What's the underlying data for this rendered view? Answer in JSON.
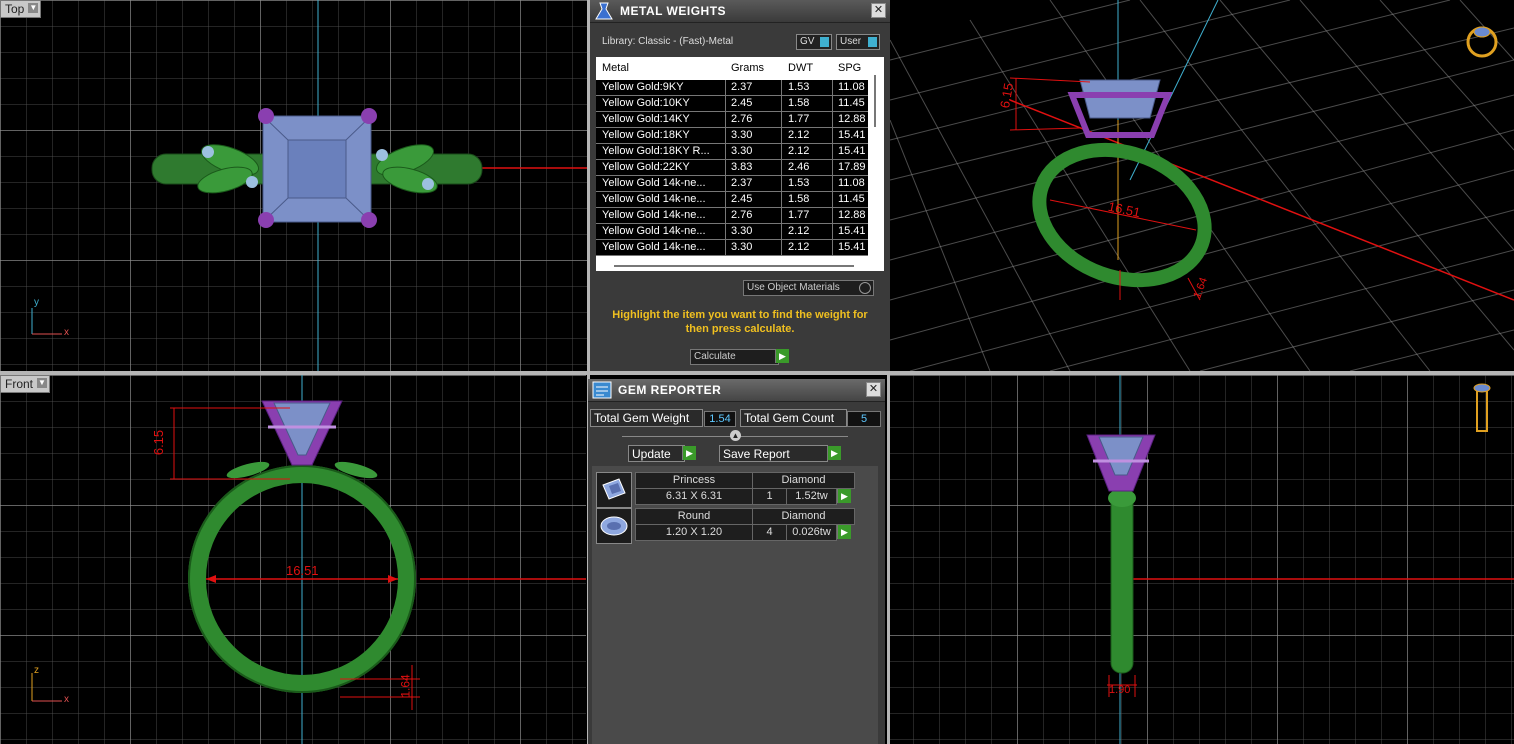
{
  "viewports": {
    "top": {
      "label": "Top",
      "axis_x": "x",
      "axis_y": "y"
    },
    "front": {
      "label": "Front",
      "axis_x": "x",
      "axis_y": "z",
      "dim_height": "6.15",
      "dim_width": "16.51",
      "dim_band": "1.64"
    },
    "perspective": {
      "dim_height": "6.15",
      "dim_width": "16.51",
      "dim_band": "1.64"
    },
    "side": {
      "dim_band": "1.90"
    }
  },
  "metal_weights": {
    "title": "METAL WEIGHTS",
    "library": "Library: Classic - (Fast)-Metal",
    "toggle_gv": "GV",
    "toggle_user": "User",
    "columns": [
      "Metal",
      "Grams",
      "DWT",
      "SPG"
    ],
    "rows": [
      [
        "Yellow Gold:9KY",
        "2.37",
        "1.53",
        "11.08"
      ],
      [
        "Yellow Gold:10KY",
        "2.45",
        "1.58",
        "11.45"
      ],
      [
        "Yellow Gold:14KY",
        "2.76",
        "1.77",
        "12.88"
      ],
      [
        "Yellow Gold:18KY",
        "3.30",
        "2.12",
        "15.41"
      ],
      [
        "Yellow Gold:18KY R...",
        "3.30",
        "2.12",
        "15.41"
      ],
      [
        "Yellow Gold:22KY",
        "3.83",
        "2.46",
        "17.89"
      ],
      [
        "Yellow Gold 14k-ne...",
        "2.37",
        "1.53",
        "11.08"
      ],
      [
        "Yellow Gold 14k-ne...",
        "2.45",
        "1.58",
        "11.45"
      ],
      [
        "Yellow Gold 14k-ne...",
        "2.76",
        "1.77",
        "12.88"
      ],
      [
        "Yellow Gold 14k-ne...",
        "3.30",
        "2.12",
        "15.41"
      ],
      [
        "Yellow Gold 14k-ne...",
        "3.30",
        "2.12",
        "15.41"
      ]
    ],
    "use_object_materials": "Use Object Materials",
    "hint": "Highlight the item you want to find the weight for then press calculate.",
    "calculate_label": "Calculate"
  },
  "gem_reporter": {
    "title": "GEM REPORTER",
    "total_weight_label": "Total Gem Weight",
    "total_weight_value": "1.54",
    "total_count_label": "Total Gem Count",
    "total_count_value": "5",
    "update_label": "Update",
    "save_report_label": "Save Report",
    "gems": [
      {
        "shape": "Princess",
        "material": "Diamond",
        "size": "6.31 X 6.31",
        "count": "1",
        "weight": "1.52tw"
      },
      {
        "shape": "Round",
        "material": "Diamond",
        "size": "1.20 X 1.20",
        "count": "4",
        "weight": "0.026tw"
      }
    ]
  },
  "colors": {
    "band": "#2f8a2f",
    "prongs": "#8a3fb0",
    "gem": "#7c90c8",
    "dimension": "#e01010",
    "axis": "#3fb0d0"
  }
}
